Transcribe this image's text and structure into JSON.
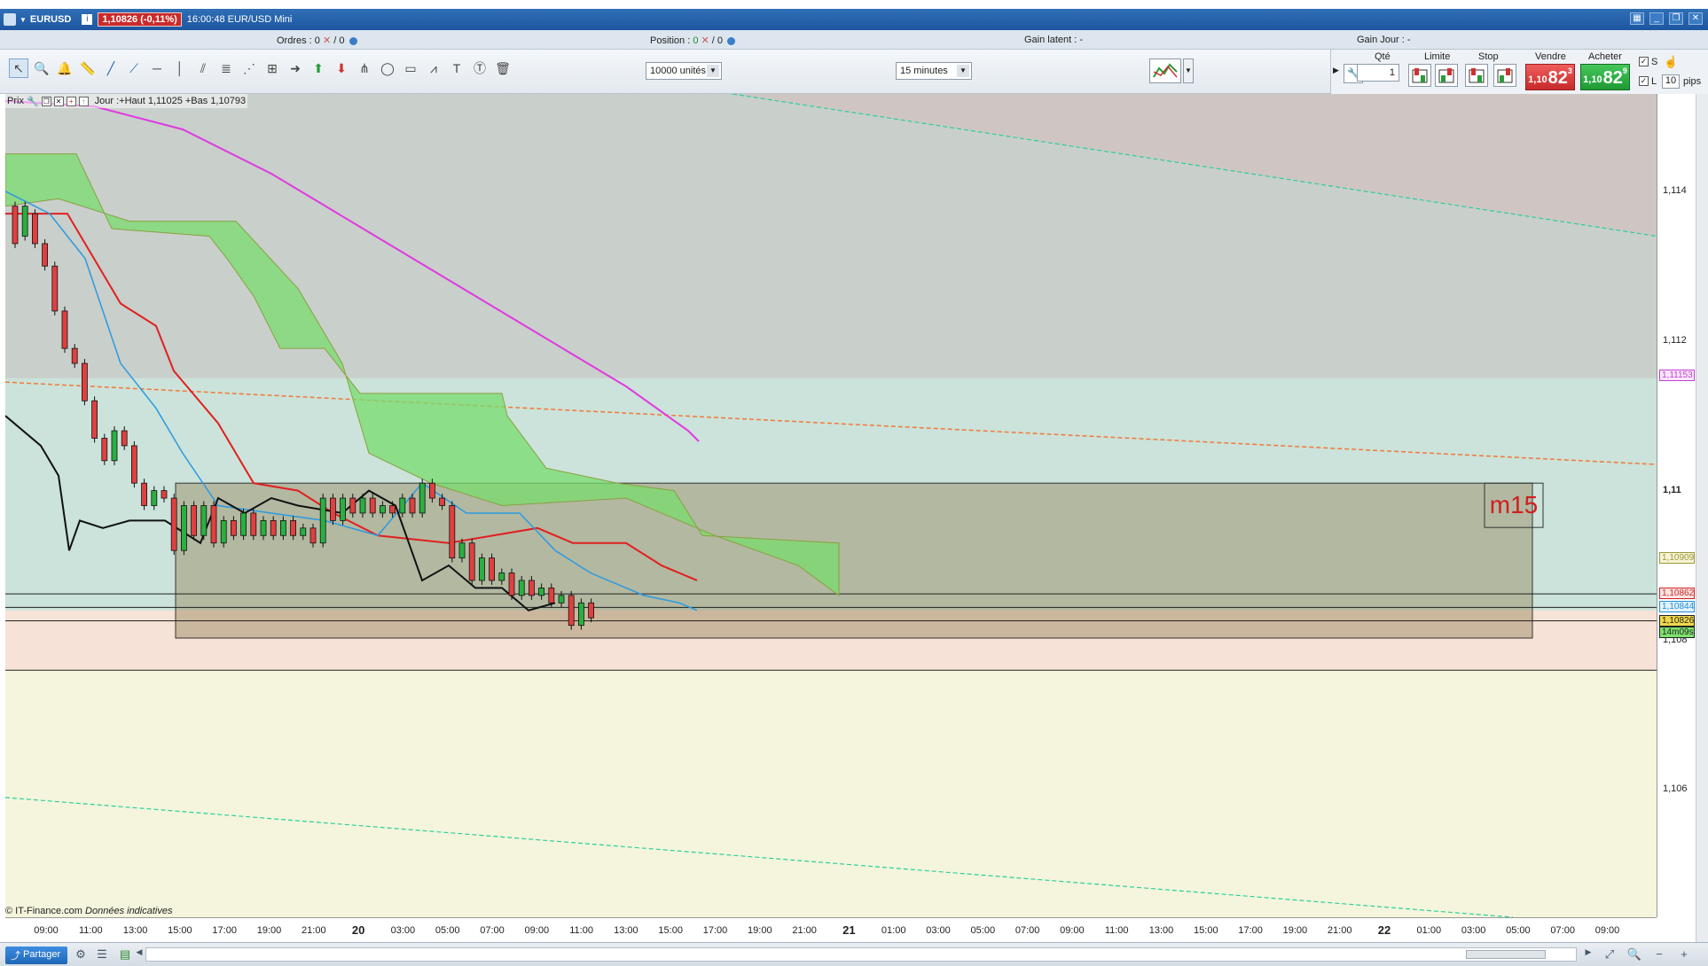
{
  "window": {
    "symbol": "EURUSD",
    "price_badge": "1,10826 (-0,11%)",
    "title": "16:00:48 EUR/USD Mini"
  },
  "infobar": {
    "orders_label": "Ordres : 0",
    "orders_sep": "/ 0",
    "position_label": "Position :",
    "position_val": "0",
    "position_sep": "/ 0",
    "gain_latent": "Gain latent : -",
    "gain_jour": "Gain Jour : -"
  },
  "toolbar": {
    "units_value": "10000 unités",
    "timeframe_value": "15 minutes",
    "tool_icons": [
      "cursor-icon",
      "zoom-icon",
      "alert-icon",
      "ruler-icon",
      "line-icon",
      "ray-icon",
      "horizontal-line-icon",
      "vertical-line-icon",
      "channel-icon",
      "fibonacci-icon",
      "fan-icon",
      "gann-icon",
      "arrow-right-icon",
      "arrow-up-icon",
      "arrow-down-icon",
      "pitchfork-icon",
      "ellipse-icon",
      "rectangle-icon",
      "polyline-icon",
      "text-icon",
      "label-icon",
      "trash-icon"
    ]
  },
  "order_panel": {
    "qty_label": "Qté",
    "qty_value": "1",
    "limit_label": "Limite",
    "stop_label": "Stop",
    "sell_label": "Vendre",
    "buy_label": "Acheter",
    "sell_small": "1,10",
    "sell_big": "82",
    "sell_sup": "3",
    "buy_small": "1,10",
    "buy_big": "82",
    "buy_sup": "9",
    "s_label": "S",
    "l_label": "L",
    "pips_value": "10",
    "pips_label": "pips"
  },
  "chart_head": {
    "label": "Prix",
    "jour": "Jour :+Haut 1,11025 +Bas 1,10793"
  },
  "chart_data": {
    "type": "candlestick",
    "symbol": "EUR/USD",
    "timeframe": "15 minutes",
    "ylim": [
      1.1043,
      1.1153
    ],
    "yticks": [
      {
        "label": "1,114",
        "value": 1.114
      },
      {
        "label": "1,112",
        "value": 1.112
      },
      {
        "label": "1,11",
        "value": 1.11
      },
      {
        "label": "1,108",
        "value": 1.108
      },
      {
        "label": "1,106",
        "value": 1.106
      }
    ],
    "price_tags": [
      {
        "label": "1,11153",
        "value": 1.11153,
        "color": "#c23fd1",
        "bg": "#fbe8fd"
      },
      {
        "label": "1,10909",
        "value": 1.10909,
        "color": "#9a9a3a",
        "bg": "#f7f4d6"
      },
      {
        "label": "1,10862",
        "value": 1.10862,
        "color": "#d02020",
        "bg": "#fde5e5"
      },
      {
        "label": "1,10844",
        "value": 1.10844,
        "color": "#1f8fd8",
        "bg": "#e3f2fc"
      },
      {
        "label": "1,10826",
        "value": 1.10826,
        "color": "#222222",
        "bg": "#f2d84a"
      },
      {
        "label": "14m09s",
        "value": 1.1081,
        "color": "#222222",
        "bg": "#7ee26e"
      }
    ],
    "x_ticks": [
      "09:00",
      "11:00",
      "13:00",
      "15:00",
      "17:00",
      "19:00",
      "21:00",
      "20",
      "03:00",
      "05:00",
      "07:00",
      "09:00",
      "11:00",
      "13:00",
      "15:00",
      "17:00",
      "19:00",
      "21:00",
      "21",
      "01:00",
      "03:00",
      "05:00",
      "07:00",
      "09:00",
      "11:00",
      "13:00",
      "15:00",
      "17:00",
      "19:00",
      "21:00",
      "22",
      "01:00",
      "03:00",
      "05:00",
      "07:00",
      "09:00"
    ],
    "day_ticks": [
      "20",
      "21",
      "22"
    ],
    "zone_label": "m15",
    "zone": {
      "top": 1.1101,
      "bottom": 1.10803
    },
    "candle_pairs": [
      [
        1.1138,
        1.1133
      ],
      [
        1.1134,
        1.1138
      ],
      [
        1.1137,
        1.1133
      ],
      [
        1.1133,
        1.113
      ],
      [
        1.113,
        1.1124
      ],
      [
        1.1124,
        1.1119
      ],
      [
        1.1119,
        1.1117
      ],
      [
        1.1117,
        1.1112
      ],
      [
        1.1112,
        1.1107
      ],
      [
        1.1107,
        1.1104
      ],
      [
        1.1104,
        1.1108
      ],
      [
        1.1108,
        1.1106
      ],
      [
        1.1106,
        1.1101
      ],
      [
        1.1101,
        1.1098
      ],
      [
        1.1098,
        1.11
      ],
      [
        1.11,
        1.1099
      ],
      [
        1.1099,
        1.1092
      ],
      [
        1.1092,
        1.1098
      ],
      [
        1.1098,
        1.1094
      ],
      [
        1.1094,
        1.1098
      ],
      [
        1.1098,
        1.1093
      ],
      [
        1.1093,
        1.1096
      ],
      [
        1.1096,
        1.1094
      ],
      [
        1.1094,
        1.1097
      ],
      [
        1.1097,
        1.1094
      ],
      [
        1.1094,
        1.1096
      ],
      [
        1.1096,
        1.1094
      ],
      [
        1.1094,
        1.1096
      ],
      [
        1.1096,
        1.1094
      ],
      [
        1.1094,
        1.1095
      ],
      [
        1.1095,
        1.1093
      ],
      [
        1.1093,
        1.1099
      ],
      [
        1.1099,
        1.1096
      ],
      [
        1.1096,
        1.1099
      ],
      [
        1.1099,
        1.1097
      ],
      [
        1.1097,
        1.1099
      ],
      [
        1.1099,
        1.1097
      ],
      [
        1.1097,
        1.1098
      ],
      [
        1.1098,
        1.1097
      ],
      [
        1.1097,
        1.1099
      ],
      [
        1.1099,
        1.1097
      ],
      [
        1.1097,
        1.1101
      ],
      [
        1.1101,
        1.1099
      ],
      [
        1.1099,
        1.1098
      ],
      [
        1.1098,
        1.1091
      ],
      [
        1.1091,
        1.1093
      ],
      [
        1.1093,
        1.1088
      ],
      [
        1.1088,
        1.1091
      ],
      [
        1.1091,
        1.1088
      ],
      [
        1.1088,
        1.1089
      ],
      [
        1.1089,
        1.1086
      ],
      [
        1.1086,
        1.1088
      ],
      [
        1.1088,
        1.1086
      ],
      [
        1.1086,
        1.1087
      ],
      [
        1.1087,
        1.1085
      ],
      [
        1.1085,
        1.1086
      ],
      [
        1.1086,
        1.1082
      ],
      [
        1.1082,
        1.1085
      ],
      [
        1.1085,
        1.1083
      ]
    ],
    "legend": []
  },
  "footer": {
    "credit": "© IT-Finance.com",
    "credit_italic": "Données indicatives",
    "share_label": "Partager"
  }
}
